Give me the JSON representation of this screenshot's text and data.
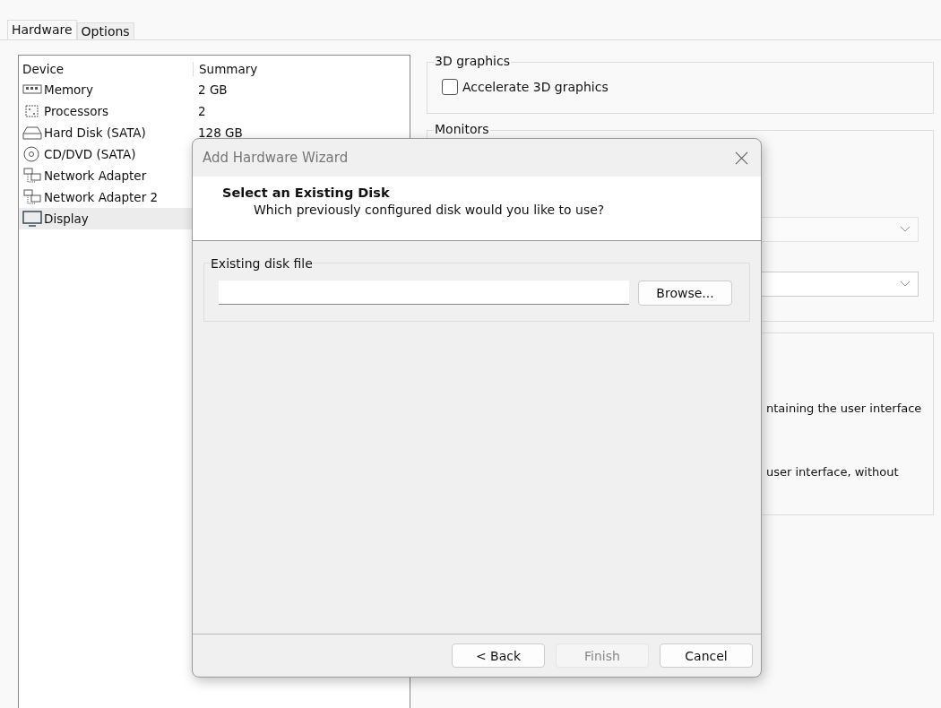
{
  "tabs": [
    {
      "label": "Hardware",
      "selected": true
    },
    {
      "label": "Options",
      "selected": false
    }
  ],
  "device_list": {
    "columns": [
      "Device",
      "Summary"
    ],
    "rows": [
      {
        "kind": "memory",
        "device": "Memory",
        "summary": "2 GB",
        "selected": false
      },
      {
        "kind": "processor",
        "device": "Processors",
        "summary": "2",
        "selected": false
      },
      {
        "kind": "disk",
        "device": "Hard Disk (SATA)",
        "summary": "128 GB",
        "selected": false
      },
      {
        "kind": "cd",
        "device": "CD/DVD (SATA)",
        "selected": false
      },
      {
        "kind": "network",
        "device": "Network Adapter",
        "selected": false
      },
      {
        "kind": "network",
        "device": "Network Adapter 2",
        "selected": false
      },
      {
        "kind": "display",
        "device": "Display",
        "selected": true
      }
    ]
  },
  "graphics": {
    "title": "3D graphics",
    "checkbox": {
      "label": "Accelerate 3D graphics",
      "checked": false
    }
  },
  "monitors": {
    "title": "Monitors"
  },
  "display_options": {
    "lines": [
      "ntaining the user interface",
      "user interface, without"
    ]
  },
  "dialog": {
    "title": "Add Hardware Wizard",
    "heading": "Select an Existing Disk",
    "subheading": "Which previously configured disk would you like to use?",
    "group_label": "Existing disk file",
    "browse": "Browse...",
    "buttons": [
      {
        "label": "< Back",
        "disabled": false
      },
      {
        "label": "Finish",
        "disabled": true
      },
      {
        "label": "Cancel",
        "disabled": false
      }
    ]
  }
}
